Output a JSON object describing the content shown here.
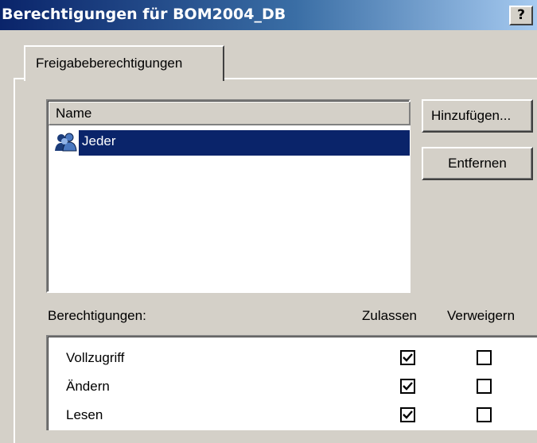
{
  "window": {
    "title": "Berechtigungen für BOM2004_DB",
    "help_label": "?"
  },
  "tabs": [
    {
      "label": "Freigabeberechtigungen",
      "active": true
    }
  ],
  "users_list": {
    "column_header": "Name",
    "items": [
      {
        "label": "Jeder",
        "icon": "group-users-icon",
        "selected": true
      }
    ]
  },
  "buttons": {
    "add_label": "Hinzufügen...",
    "remove_label": "Entfernen"
  },
  "permissions": {
    "label": "Berechtigungen:",
    "allow_header": "Zulassen",
    "deny_header": "Verweigern",
    "rows": [
      {
        "name": "Vollzugriff",
        "allow": true,
        "deny": false
      },
      {
        "name": "Ändern",
        "allow": true,
        "deny": false
      },
      {
        "name": "Lesen",
        "allow": true,
        "deny": false
      }
    ]
  },
  "colors": {
    "selection": "#0a246a",
    "dialog_bg": "#d4d0c8"
  }
}
